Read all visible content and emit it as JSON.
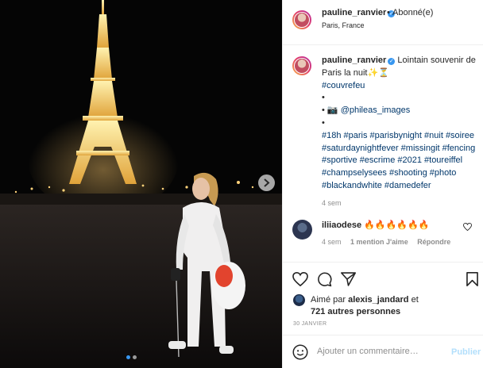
{
  "post": {
    "username": "pauline_ranvier",
    "follow_state": "Abonné(e)",
    "separator": "•",
    "location": "Paris, France"
  },
  "caption": {
    "username": "pauline_ranvier",
    "text": "Lointain souvenir de Paris la nuit",
    "emojis": "✨⏳",
    "tag_1": "#couvrefeu",
    "bullet_1": "•",
    "bullet_2": "•",
    "mention": "@phileas_images",
    "bullet_3": "•",
    "hashtags": "#18h #paris #parisbynight #nuit #soiree #saturdaynightfever #missingit #fencing #sportive #escrime #2021 #toureiffel #champselysees #shooting #photo #blackandwhite #damedefer",
    "time": "4 sem"
  },
  "comment": {
    "username": "iliiaodese",
    "text": "🔥🔥🔥🔥🔥🔥",
    "time": "4 sem",
    "likes": "1 mention J'aime",
    "reply": "Répondre"
  },
  "likes": {
    "prefix": "Aimé par",
    "liker": "alexis_jandard",
    "conj": "et",
    "others": "721 autres personnes"
  },
  "date": "30 JANVIER",
  "add_comment": {
    "placeholder": "Ajouter un commentaire…",
    "publish": "Publier"
  },
  "carousel": {
    "slides": 2,
    "active": 0
  },
  "colors": {
    "link": "#00376b",
    "verified": "#3897f0",
    "muted": "#8e8e8e",
    "publish_disabled": "#b2dffc"
  }
}
